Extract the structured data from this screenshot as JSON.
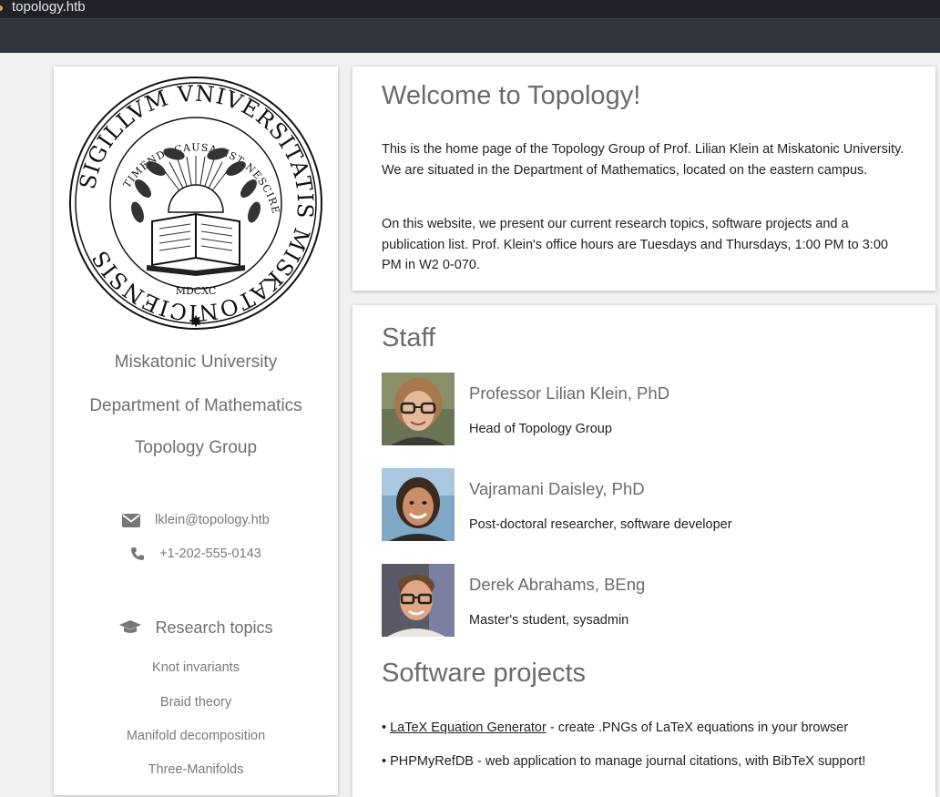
{
  "window": {
    "title": "topology.htb"
  },
  "sidebar": {
    "seal": {
      "outer_text": "SIGILLVM VNIVERSITATIS MISKATONICIENSIS",
      "inner_text": "TIMENDI CAUSA EST NESCIRE",
      "year": "MDCXC"
    },
    "university": "Miskatonic University",
    "department": "Department of Mathematics",
    "group": "Topology Group",
    "email": "lklein@topology.htb",
    "phone": "+1-202-555-0143",
    "research_title": "Research topics",
    "topics": [
      "Knot invariants",
      "Braid theory",
      "Manifold decomposition",
      "Three-Manifolds"
    ]
  },
  "welcome": {
    "title": "Welcome to Topology!",
    "para1": "This is the home page of the Topology Group of Prof. Lilian Klein at Miskatonic University. We are situated in the Department of Mathematics, located on the eastern campus.",
    "para2": "On this website, we present our current research topics, software projects and a publication list. Prof. Klein's office hours are Tuesdays and Thursdays, 1:00 PM to 3:00 PM in W2 0-070."
  },
  "staff": {
    "title": "Staff",
    "members": [
      {
        "name": "Professor Lilian Klein, PhD",
        "role": "Head of Topology Group"
      },
      {
        "name": "Vajramani Daisley, PhD",
        "role": "Post-doctoral researcher, software developer"
      },
      {
        "name": "Derek Abrahams, BEng",
        "role": "Master's student, sysadmin"
      }
    ]
  },
  "software": {
    "title": "Software projects",
    "items": [
      {
        "bullet": "• ",
        "link": "LaTeX Equation Generator",
        "desc": " - create .PNGs of LaTeX equations in your browser"
      },
      {
        "bullet": "• ",
        "name": "PHPMyRefDB",
        "desc": " - web application to manage journal citations, with BibTeX support!"
      }
    ]
  },
  "colors": {
    "titlebar": "#212229",
    "toolbar": "#32343d",
    "background": "#f0f0f0",
    "heading": "#6b6b6b"
  }
}
